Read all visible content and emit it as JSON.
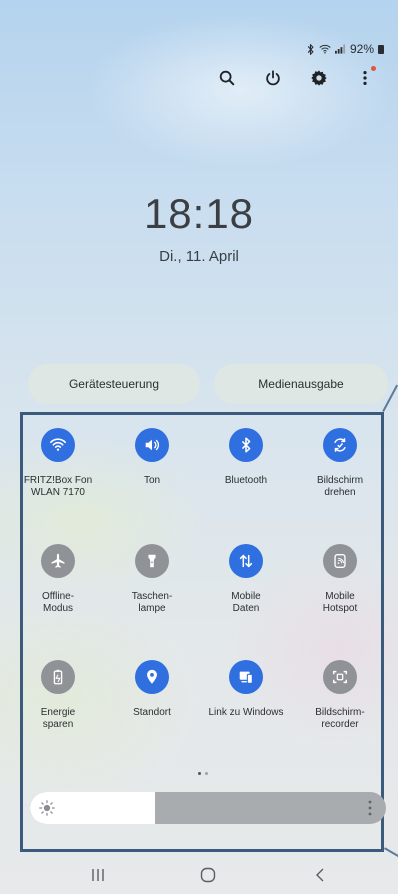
{
  "status_bar": {
    "battery": "92%",
    "icons": [
      "bluetooth-icon",
      "wifi-icon",
      "signal-icon",
      "battery-icon"
    ]
  },
  "toolbar": {
    "buttons": [
      "search-icon",
      "power-icon",
      "gear-icon",
      "more-vertical-icon"
    ]
  },
  "clock": {
    "time": "18:18",
    "date": "Di., 11. April"
  },
  "pills": {
    "device_control": "Gerätesteuerung",
    "media_output": "Medienausgabe"
  },
  "tiles": [
    {
      "label": "FRITZ!Box Fon\nWLAN 7170",
      "icon": "wifi-icon",
      "active": true
    },
    {
      "label": "Ton",
      "icon": "sound-icon",
      "active": true
    },
    {
      "label": "Bluetooth",
      "icon": "bluetooth-icon",
      "active": true
    },
    {
      "label": "Bildschirm\ndrehen",
      "icon": "auto-rotate-icon",
      "active": true
    },
    {
      "label": "Offline-\nModus",
      "icon": "airplane-icon",
      "active": false
    },
    {
      "label": "Taschen-\nlampe",
      "icon": "flashlight-icon",
      "active": false
    },
    {
      "label": "Mobile\nDaten",
      "icon": "mobile-data-icon",
      "active": true
    },
    {
      "label": "Mobile\nHotspot",
      "icon": "hotspot-icon",
      "active": false
    },
    {
      "label": "Energie\nsparen",
      "icon": "battery-saver-icon",
      "active": false
    },
    {
      "label": "Standort",
      "icon": "location-icon",
      "active": true
    },
    {
      "label": "Link zu Windows",
      "icon": "link-to-windows-icon",
      "active": true
    },
    {
      "label": "Bildschirm-\nrecorder",
      "icon": "screen-recorder-icon",
      "active": false
    }
  ],
  "pager": {
    "pages": 2,
    "current": 1
  },
  "brightness": {
    "level": 0.35
  },
  "navbar": [
    "recent-apps-icon",
    "home-icon",
    "back-icon"
  ],
  "colors": {
    "accent": "#2f6fe0",
    "inactive": "#8f9398",
    "annotation_border": "#3b5a7c"
  }
}
